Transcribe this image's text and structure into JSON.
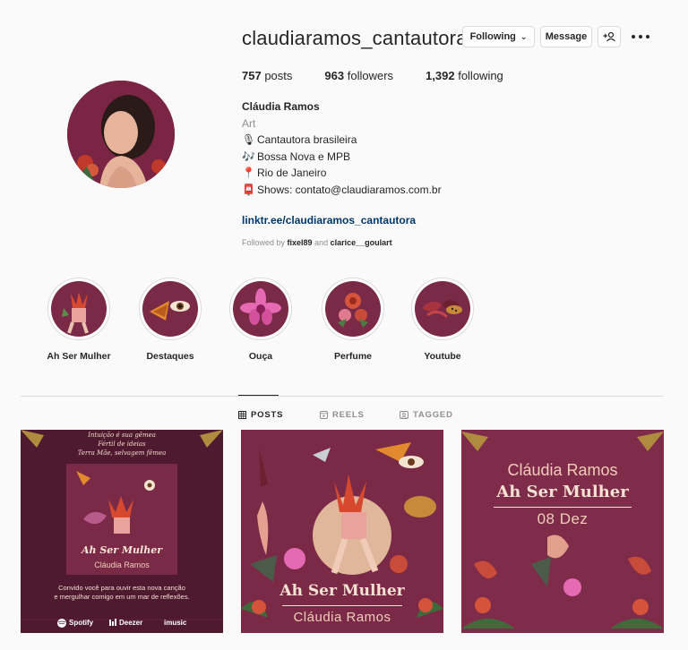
{
  "profile": {
    "username": "claudiaramos_cantautora",
    "following_label": "Following",
    "message_label": "Message",
    "suggest_label": "+Α"
  },
  "stats": {
    "posts": "757",
    "posts_label": "posts",
    "followers": "963",
    "followers_label": "followers",
    "following": "1,392",
    "following_label": "following"
  },
  "bio": {
    "name": "Cláudia Ramos",
    "category": "Art",
    "lines": [
      {
        "icon": "🎙",
        "text": "Cantautora brasileira"
      },
      {
        "icon": "🎶",
        "text": "Bossa Nova e MPB"
      },
      {
        "icon": "📍",
        "text": "Rio de Janeiro"
      },
      {
        "icon": "📮",
        "text": "Shows: contato@claudiaramos.com.br"
      }
    ],
    "link": "linktr.ee/claudiaramos_cantautora",
    "followed_by_prefix": "Followed by",
    "followed_by_user1": "fixel89",
    "followed_by_and": "and",
    "followed_by_user2": "clarice__goulart"
  },
  "highlights": [
    {
      "label": "Ah Ser Mulher"
    },
    {
      "label": "Destaques"
    },
    {
      "label": "Ouça"
    },
    {
      "label": "Perfume"
    },
    {
      "label": "Youtube"
    }
  ],
  "tabs": {
    "posts": "POSTS",
    "reels": "REELS",
    "tagged": "TAGGED"
  },
  "posts": {
    "p1": {
      "poem1": "Intuição é sua gêmea",
      "poem2": "Fértil de ideias",
      "poem3": "Terra Mãe, selvagem fêmea",
      "title": "Ah Ser Mulher",
      "artist": "Cláudia Ramos",
      "invite1": "Convido você para ouvir esta nova canção",
      "invite2": "e mergulhar comigo em um mar de reflexões.",
      "svc1": "Spotify",
      "svc2": "Deezer",
      "svc3": "imusic"
    },
    "p2": {
      "title": "Ah Ser Mulher",
      "artist": "Cláudia Ramos"
    },
    "p3": {
      "artist": "Cláudia Ramos",
      "title": "Ah Ser Mulher",
      "date": "08 Dez"
    }
  },
  "colors": {
    "wine": "#7a2a47",
    "dark_wine": "#4f1a30",
    "link": "#00376b",
    "muted": "#8e8e8e"
  }
}
